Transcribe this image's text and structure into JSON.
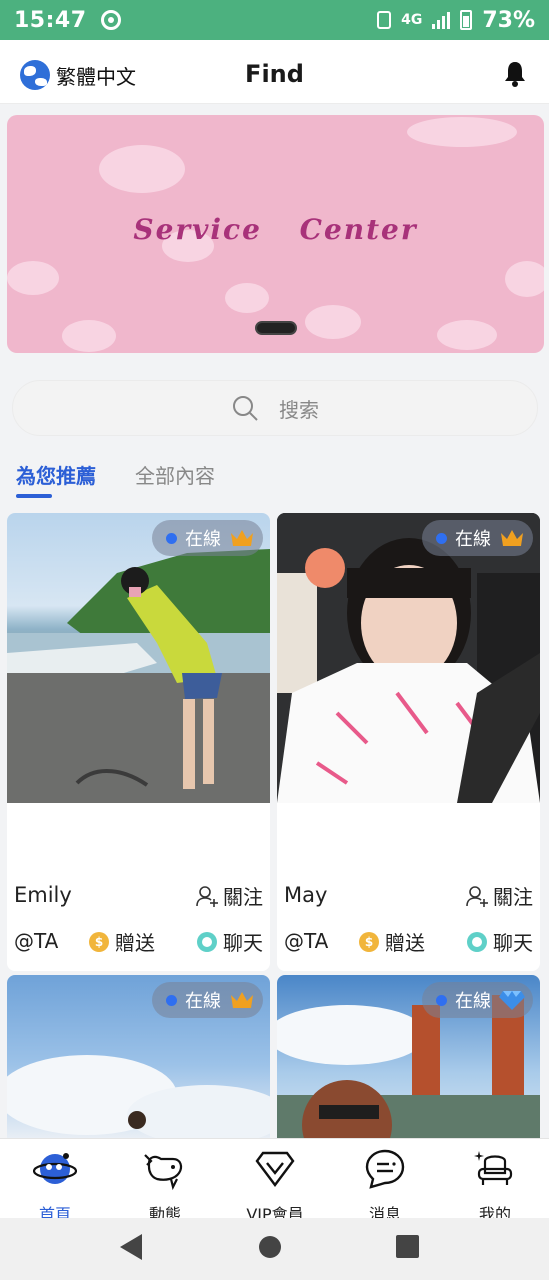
{
  "status_bar": {
    "time": "15:47",
    "network": "4G",
    "battery": "73%"
  },
  "header": {
    "language": "繁體中文",
    "title": "Find"
  },
  "banner": {
    "text": "Service Center"
  },
  "search": {
    "placeholder": "搜索"
  },
  "tabs": [
    {
      "label": "為您推薦",
      "active": true
    },
    {
      "label": "全部內容",
      "active": false
    }
  ],
  "cards": [
    {
      "status": "在線",
      "badge_icon": "crown-icon",
      "name": "Emily",
      "follow_label": "關注",
      "handle": "@TA",
      "gift_label": "贈送",
      "chat_label": "聊天"
    },
    {
      "status": "在線",
      "badge_icon": "crown-icon",
      "name": "May",
      "follow_label": "關注",
      "handle": "@TA",
      "gift_label": "贈送",
      "chat_label": "聊天"
    },
    {
      "status": "在線",
      "badge_icon": "crown-icon"
    },
    {
      "status": "在線",
      "badge_icon": "diamond-icon"
    }
  ],
  "bottom_nav": [
    {
      "label": "首頁",
      "icon": "planet-icon",
      "active": true
    },
    {
      "label": "動態",
      "icon": "whale-icon",
      "active": false
    },
    {
      "label": "VIP會員",
      "icon": "vip-diamond-icon",
      "active": false
    },
    {
      "label": "消息",
      "icon": "message-icon",
      "active": false
    },
    {
      "label": "我的",
      "icon": "profile-chair-icon",
      "active": false
    }
  ],
  "colors": {
    "status_bar": "#4cb17f",
    "accent": "#2c5fd6",
    "banner_bg": "#f0b7cc",
    "banner_text": "#a8327a",
    "crown": "#f0a020",
    "gift_coin": "#f1b53b",
    "chat": "#5fd0c8"
  }
}
